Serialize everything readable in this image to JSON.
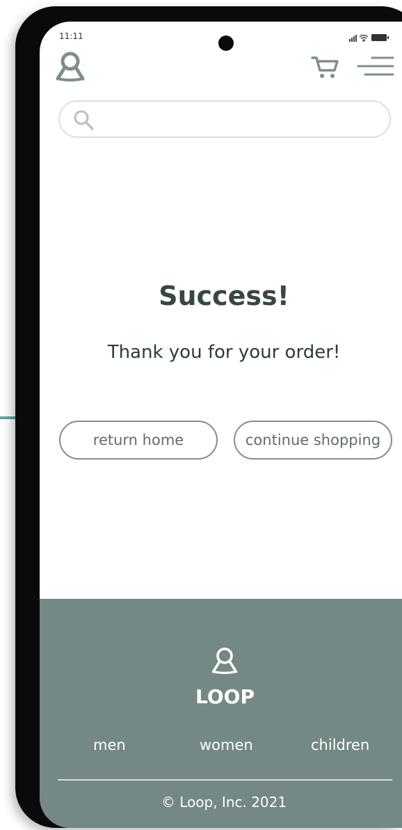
{
  "status_bar": {
    "time": "11:11"
  },
  "header": {
    "logo_icon": "loop-logo-icon",
    "cart_icon": "cart-icon",
    "menu_icon": "hamburger-menu-icon"
  },
  "search": {
    "value": "",
    "placeholder": "",
    "icon": "search-icon"
  },
  "main": {
    "title": "Success!",
    "message": "Thank you for your order!",
    "return_home_label": "return home",
    "continue_shopping_label": "continue shopping"
  },
  "footer": {
    "brand": "LOOP",
    "nav": [
      "men",
      "women",
      "children"
    ],
    "copyright": "© Loop, Inc. 2021"
  },
  "colors": {
    "footer_bg": "#748886",
    "title_text": "#384645",
    "button_border": "#7f8e8d",
    "accent_teal": "#5aa8a3"
  }
}
